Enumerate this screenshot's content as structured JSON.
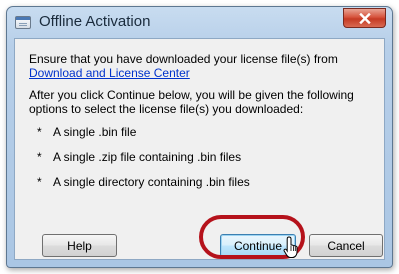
{
  "window": {
    "title": "Offline Activation",
    "close_icon": "close-icon",
    "title_icon": "window-icon",
    "close_color": "#c53a24"
  },
  "content": {
    "line1": "Ensure that you have downloaded your license file(s) from",
    "link": "Download and License Center",
    "para2_line1": "After you click Continue below, you will be given the following",
    "para2_line2": "options to select the license file(s) you downloaded:",
    "bullet_marker": "*",
    "bullets": [
      "A single .bin file",
      "A single .zip file containing .bin files",
      "A single directory containing .bin files"
    ]
  },
  "buttons": {
    "help": "Help",
    "continue": "Continue",
    "cancel": "Cancel"
  },
  "annotation": {
    "ring_color": "#b5121b"
  }
}
